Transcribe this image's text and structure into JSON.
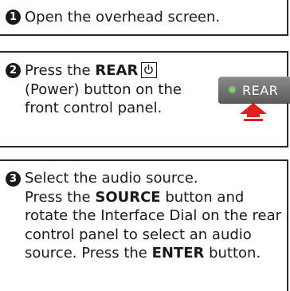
{
  "steps": [
    {
      "number": "1",
      "text": "Open the overhead screen."
    },
    {
      "number": "2",
      "text_before": "Press the ",
      "bold": "REAR",
      "text_after": " (Power) button on the front control panel.",
      "power_icon": "power-symbol-icon",
      "illustration": {
        "button_label": "REAR",
        "led_color": "#7bd16a",
        "arrow_color": "#e02020",
        "icon": "press-arrow-icon"
      }
    },
    {
      "number": "3",
      "line1": "Select the audio source.",
      "text_a": "Press the ",
      "bold_a": "SOURCE",
      "text_b": " button and rotate the Interface Dial on the rear control panel to select an audio source. Press the ",
      "bold_b": "ENTER",
      "text_c": " button."
    }
  ]
}
